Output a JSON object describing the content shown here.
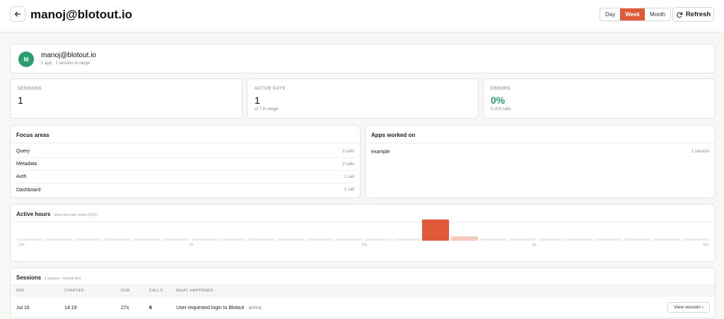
{
  "header": {
    "back_icon": "arrow-left-icon",
    "title": "manoj@blotout.io",
    "ranges": [
      {
        "label": "Day",
        "active": false
      },
      {
        "label": "Week",
        "active": true
      },
      {
        "label": "Month",
        "active": false
      }
    ],
    "refresh_label": "Refresh",
    "refresh_icon": "refresh-icon"
  },
  "user": {
    "initial": "M",
    "name": "manoj@blotout.io",
    "summary": "1 app · 1 session in range",
    "avatar_color": "#2e9d6e"
  },
  "stats": [
    {
      "label": "SESSIONS",
      "value": "1",
      "sub": ""
    },
    {
      "label": "ACTIVE DAYS",
      "value": "1",
      "sub": "of 7 in range"
    },
    {
      "label": "ERRORS",
      "value": "0%",
      "sub": "0 of 6 calls"
    }
  ],
  "focus_areas": {
    "title": "Focus areas",
    "items": [
      {
        "name": "Query",
        "count": "2 calls"
      },
      {
        "name": "Metadata",
        "count": "2 calls"
      },
      {
        "name": "Auth",
        "count": "1 call"
      },
      {
        "name": "Dashboard",
        "count": "1 call"
      }
    ]
  },
  "apps": {
    "title": "Apps worked on",
    "items": [
      {
        "name": "example",
        "count": "1 session"
      }
    ]
  },
  "active_hours": {
    "title": "Active hours",
    "subtitle": "when this user works (UTC)",
    "tick_labels": [
      "12a",
      "6a",
      "12p",
      "6p",
      "11p"
    ],
    "levels": [
      0,
      0,
      0,
      0,
      0,
      0,
      0,
      0,
      0,
      0,
      0,
      0,
      0,
      0,
      1,
      0.2,
      0,
      0,
      0,
      0,
      0,
      0,
      0,
      0
    ],
    "accent": "#e05a3a"
  },
  "sessions": {
    "title": "Sessions",
    "subtitle": "1 session · newest first",
    "columns": [
      "DAY",
      "STARTED",
      "DUR",
      "CALLS",
      "WHAT HAPPENED"
    ],
    "rows": [
      {
        "day": "Jul 16",
        "started": "14:19",
        "dur": "27s",
        "calls": "6",
        "what": "User requested login to Blotout",
        "who": "· armra",
        "action": "View session ›"
      }
    ]
  }
}
